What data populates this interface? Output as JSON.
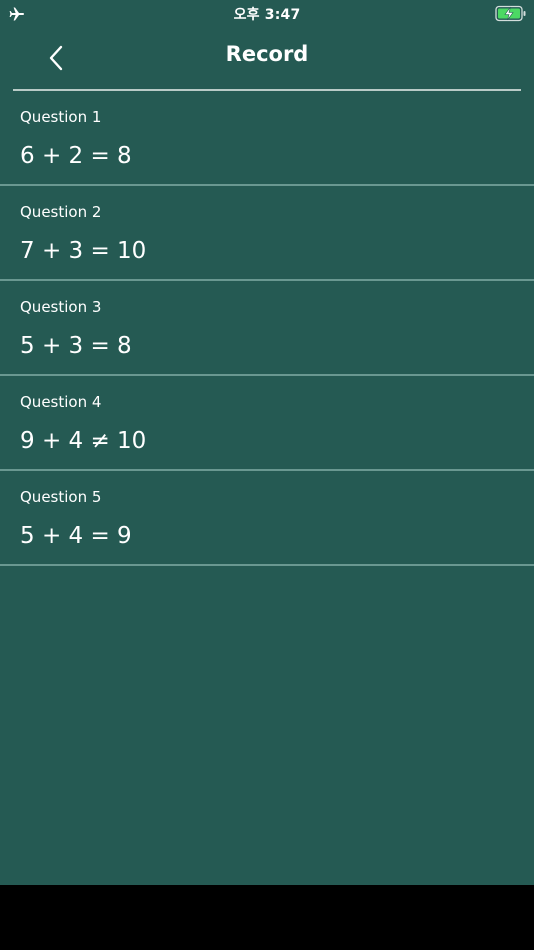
{
  "colors": {
    "background": "#255a53",
    "text": "#ffffff",
    "divider": "#6a9891",
    "battery_charge": "#4cd964"
  },
  "status_bar": {
    "time": "오후 3:47",
    "left_icon": "airplane-icon",
    "right_icon": "battery-charging-icon"
  },
  "nav": {
    "back_icon": "chevron-left-icon",
    "title": "Record"
  },
  "records": [
    {
      "label": "Question 1",
      "equation": "6 + 2 = 8"
    },
    {
      "label": "Question 2",
      "equation": "7 + 3 = 10"
    },
    {
      "label": "Question 3",
      "equation": "5 + 3 = 8"
    },
    {
      "label": "Question 4",
      "equation": "9 + 4 ≠ 10"
    },
    {
      "label": "Question 5",
      "equation": "5 + 4 = 9"
    }
  ]
}
